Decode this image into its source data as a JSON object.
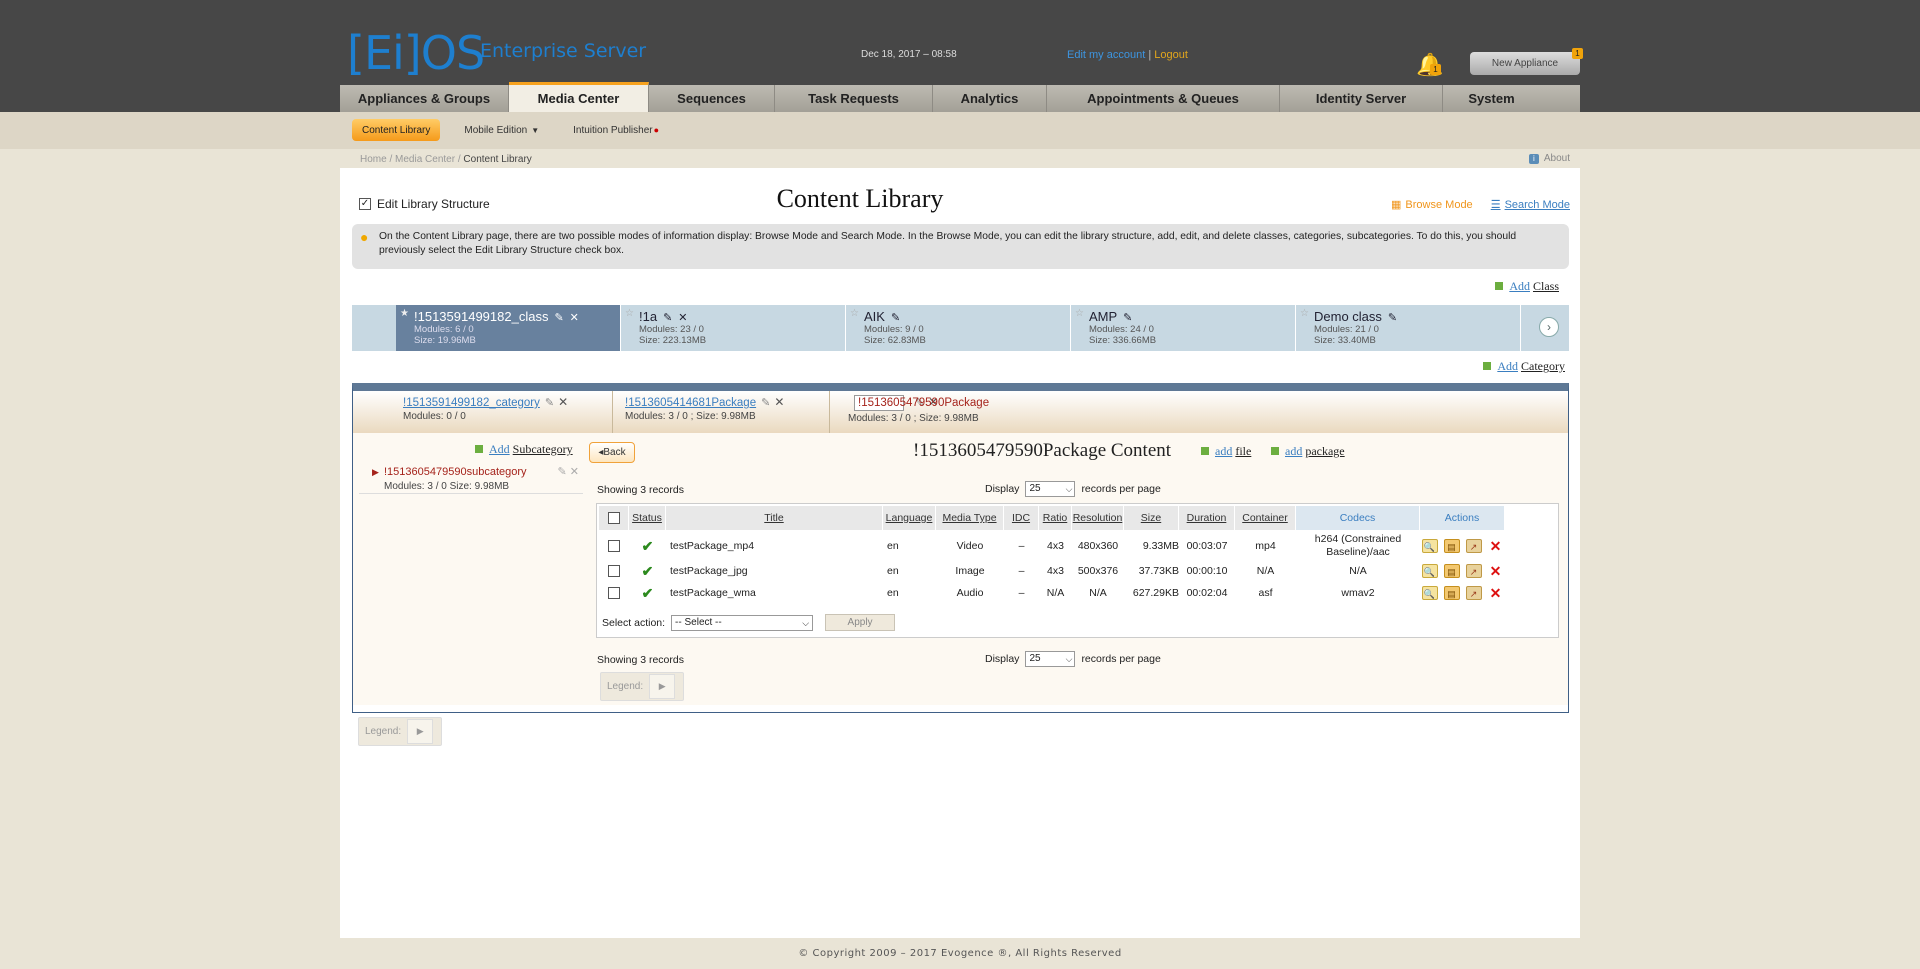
{
  "header": {
    "logo": "[Ei]OS",
    "tagline": "Enterprise Server",
    "datetime": "Dec 18, 2017 – 08:58",
    "edit_account": "Edit my account",
    "separator": "|",
    "logout": "Logout",
    "notifications_count": "1",
    "new_appliance": "New Appliance",
    "new_appliance_count": "1"
  },
  "main_nav": [
    {
      "label": "Appliances & Groups",
      "active": false
    },
    {
      "label": "Media Center",
      "active": true
    },
    {
      "label": "Sequences",
      "active": false
    },
    {
      "label": "Task Requests",
      "active": false
    },
    {
      "label": "Analytics",
      "active": false
    },
    {
      "label": "Appointments & Queues",
      "active": false
    },
    {
      "label": "Identity Server",
      "active": false
    },
    {
      "label": "System",
      "active": false
    }
  ],
  "sub_nav": {
    "content_library": "Content Library",
    "mobile_edition": "Mobile Edition",
    "intuition_publisher": "Intuition Publisher"
  },
  "breadcrumb": {
    "home": "Home",
    "media_center": "Media Center",
    "current": "Content Library",
    "about": "About"
  },
  "page": {
    "edit_structure_label": "Edit Library Structure",
    "edit_structure_checked": true,
    "title": "Content Library",
    "browse_mode": "Browse Mode",
    "search_mode": "Search Mode",
    "info_text": "On the Content Library page, there are two possible modes of information display: Browse Mode and Search Mode. In the Browse Mode, you can edit the library structure, add, edit, and delete classes, categories, subcategories. To do this, you should previously select the Edit Library Structure check box.",
    "add": "Add",
    "class_word": "Class",
    "category_word": "Category",
    "subcategory_word": "Subcategory"
  },
  "classes": [
    {
      "name": "!1513591499182_class",
      "modules": "Modules: 6 / 0",
      "size": "Size: 19.96MB",
      "active": true
    },
    {
      "name": "!1a",
      "modules": "Modules: 23 / 0",
      "size": "Size: 223.13MB",
      "active": false
    },
    {
      "name": "AIK",
      "modules": "Modules: 9 / 0",
      "size": "Size: 62.83MB",
      "active": false
    },
    {
      "name": "AMP",
      "modules": "Modules: 24 / 0",
      "size": "Size: 336.66MB",
      "active": false
    },
    {
      "name": "Demo class",
      "modules": "Modules: 21 / 0",
      "size": "Size: 33.40MB",
      "active": false
    }
  ],
  "categories": [
    {
      "name": "!1513591499182_category",
      "meta": "Modules: 0 / 0",
      "selected": false
    },
    {
      "name": "!1513605414681Package",
      "meta": "Modules: 3 / 0 ;   Size:  9.98MB",
      "selected": false
    },
    {
      "name": "!1513605479590Package",
      "meta": "Modules: 3 / 0 ;   Size:  9.98MB",
      "selected": true
    }
  ],
  "subcategory": {
    "name": "!1513605479590subcategory",
    "modules": "Modules: 3 / 0",
    "size": "Size: 9.98MB"
  },
  "package": {
    "back": "Back",
    "title": "!1513605479590Package  Content",
    "add_file_a": "add",
    "add_file_b": "file",
    "add_package_a": "add",
    "add_package_b": "package",
    "showing": "Showing 3 records",
    "display": "Display",
    "per_page_value": "25",
    "per_page_suffix": "records per page",
    "select_action_label": "Select action:",
    "select_action_value": "-- Select --",
    "apply": "Apply",
    "legend": "Legend:"
  },
  "table": {
    "headers": [
      "Status",
      "Title",
      "Language",
      "Media Type",
      "IDC",
      "Ratio",
      "Resolution",
      "Size",
      "Duration",
      "Container",
      "Codecs",
      "Actions"
    ],
    "rows": [
      {
        "title": "testPackage_mp4",
        "language": "en",
        "media_type": "Video",
        "idc": "–",
        "ratio": "4x3",
        "resolution": "480x360",
        "size": "9.33MB",
        "duration": "00:03:07",
        "container": "mp4",
        "codecs": "h264 (Constrained Baseline)/aac"
      },
      {
        "title": "testPackage_jpg",
        "language": "en",
        "media_type": "Image",
        "idc": "–",
        "ratio": "4x3",
        "resolution": "500x376",
        "size": "37.73KB",
        "duration": "00:00:10",
        "container": "N/A",
        "codecs": "N/A"
      },
      {
        "title": "testPackage_wma",
        "language": "en",
        "media_type": "Audio",
        "idc": "–",
        "ratio": "N/A",
        "resolution": "N/A",
        "size": "627.29KB",
        "duration": "00:02:04",
        "container": "asf",
        "codecs": "wmav2"
      }
    ]
  },
  "footer": {
    "copyright": "© Copyright 2009 – 2017 Evogence ®, All Rights Reserved"
  },
  "colors": {
    "brand_blue": "#1e7fcf",
    "accent_orange": "#f7a21e",
    "selected_red": "#a5231b"
  }
}
